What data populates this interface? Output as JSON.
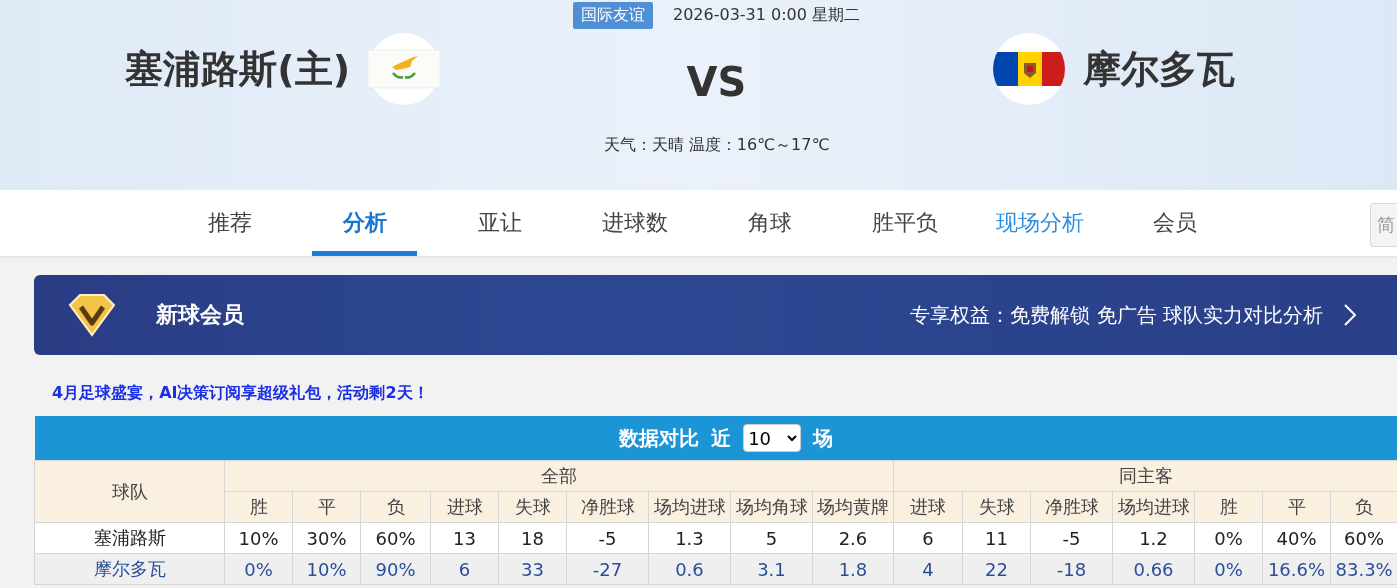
{
  "match": {
    "competition": "国际友谊",
    "datetime": "2026-03-31 0:00 星期二",
    "home": {
      "name": "塞浦路斯(主)"
    },
    "versus": "VS",
    "away": {
      "name": "摩尔多瓦"
    },
    "weather": "天气：天晴 温度：16℃～17℃"
  },
  "tabs": [
    {
      "label": "推荐",
      "selected": false,
      "kind": "plain"
    },
    {
      "label": "分析",
      "selected": true,
      "kind": "plain"
    },
    {
      "label": "亚让",
      "selected": false,
      "kind": "plain"
    },
    {
      "label": "进球数",
      "selected": false,
      "kind": "plain"
    },
    {
      "label": "角球",
      "selected": false,
      "kind": "plain"
    },
    {
      "label": "胜平负",
      "selected": false,
      "kind": "plain"
    },
    {
      "label": "现场分析",
      "selected": false,
      "kind": "live"
    },
    {
      "label": "会员",
      "selected": false,
      "kind": "plain"
    }
  ],
  "language_button": "简",
  "vip_banner": {
    "title": "新球会员",
    "benefits": "专享权益：免费解锁 免广告 球队实力对比分析"
  },
  "promo": "4月足球盛宴，AI决策订阅享超级礼包，活动剩2天！",
  "comparison": {
    "title": "数据对比",
    "recent_prefix": "近",
    "recent_count": "10",
    "recent_suffix": "场",
    "team_header": "球队",
    "groups": [
      {
        "label": "全部",
        "columns": [
          "胜",
          "平",
          "负",
          "进球",
          "失球",
          "净胜球",
          "场均进球",
          "场均角球",
          "场均黄牌"
        ]
      },
      {
        "label": "同主客",
        "columns": [
          "进球",
          "失球",
          "净胜球",
          "场均进球",
          "胜",
          "平",
          "负"
        ]
      }
    ],
    "rows": [
      {
        "team": "塞浦路斯",
        "values": [
          "10%",
          "30%",
          "60%",
          "13",
          "18",
          "-5",
          "1.3",
          "5",
          "2.6",
          "6",
          "11",
          "-5",
          "1.2",
          "0%",
          "40%",
          "60%"
        ]
      },
      {
        "team": "摩尔多瓦",
        "values": [
          "0%",
          "10%",
          "90%",
          "6",
          "33",
          "-27",
          "0.6",
          "3.1",
          "1.8",
          "4",
          "22",
          "-18",
          "0.66",
          "0%",
          "16.6%",
          "83.3%"
        ]
      }
    ]
  }
}
